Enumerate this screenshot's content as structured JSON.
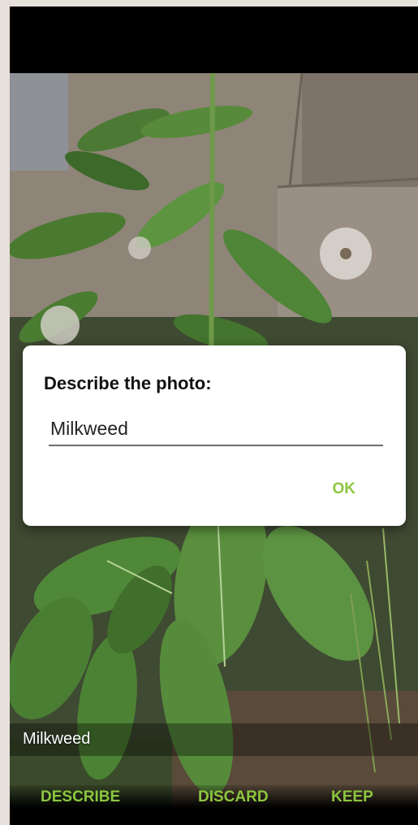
{
  "dialog": {
    "title": "Describe the photo:",
    "input_value": "Milkweed",
    "ok_label": "OK"
  },
  "photo": {
    "caption": "Milkweed"
  },
  "bottom_bar": {
    "describe_label": "DESCRIBE",
    "discard_label": "DISCARD",
    "keep_label": "KEEP"
  },
  "colors": {
    "accent": "#8cc63f",
    "status_bar": "#000000"
  }
}
